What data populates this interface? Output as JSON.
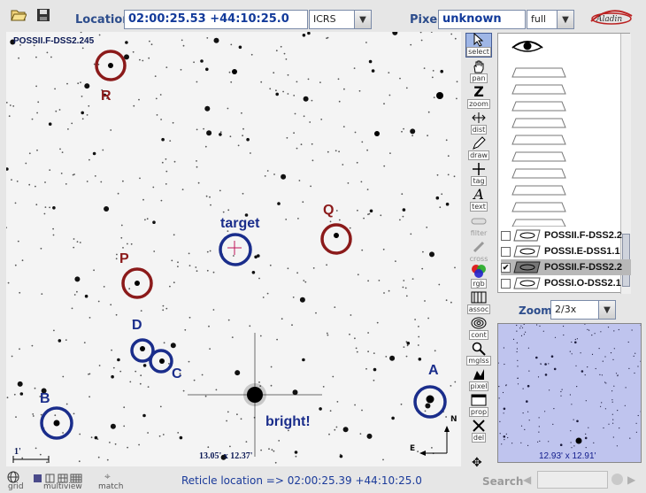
{
  "toolbar": {
    "location_label": "Location",
    "location_value": "02:00:25.53 +44:10:25.0",
    "frame_value": "ICRS",
    "pixel_label": "Pixel",
    "pixel_value": "unknown",
    "pixel_mode": "full",
    "logo_text": "Aladin"
  },
  "image": {
    "title": "POSSII.F-DSS2.245",
    "size_text": "13.05' x 12.37'",
    "scale_label": "1'",
    "compass_n": "N",
    "compass_e": "E",
    "annotations": [
      {
        "label": "R",
        "color": "#8b1a1a"
      },
      {
        "label": "Q",
        "color": "#8b1a1a"
      },
      {
        "label": "P",
        "color": "#8b1a1a"
      },
      {
        "label": "target",
        "color": "#1a2d8b"
      },
      {
        "label": "D",
        "color": "#1a2d8b"
      },
      {
        "label": "C",
        "color": "#1a2d8b"
      },
      {
        "label": "B",
        "color": "#1a2d8b"
      },
      {
        "label": "A",
        "color": "#1a2d8b"
      },
      {
        "label": "bright!",
        "color": "#1a2d8b"
      }
    ]
  },
  "tools": [
    {
      "name": "select",
      "icon": "arrow-icon",
      "selected": true
    },
    {
      "name": "pan",
      "icon": "hand-icon"
    },
    {
      "name": "zoom",
      "icon": "zoom-icon"
    },
    {
      "name": "dist",
      "icon": "distance-icon"
    },
    {
      "name": "draw",
      "icon": "pencil-icon"
    },
    {
      "name": "tag",
      "icon": "tag-icon"
    },
    {
      "name": "text",
      "icon": "text-icon"
    },
    {
      "name": "filter",
      "icon": "filter-icon",
      "disabled": true
    },
    {
      "name": "cross",
      "icon": "cross-icon",
      "disabled": true
    },
    {
      "name": "rgb",
      "icon": "rgb-icon"
    },
    {
      "name": "assoc",
      "icon": "assoc-icon"
    },
    {
      "name": "cont",
      "icon": "contour-icon"
    },
    {
      "name": "mglss",
      "icon": "magnifier-icon"
    },
    {
      "name": "pixel",
      "icon": "pixel-icon"
    },
    {
      "name": "prop",
      "icon": "properties-icon"
    },
    {
      "name": "del",
      "icon": "delete-icon"
    }
  ],
  "layers": [
    {
      "name": "POSSII.F-DSS2.2",
      "checked": false,
      "selected": false
    },
    {
      "name": "POSSI.E-DSS1.1",
      "checked": false,
      "selected": false
    },
    {
      "name": "POSSII.F-DSS2.2",
      "checked": true,
      "selected": true
    },
    {
      "name": "POSSI.O-DSS2.1",
      "checked": false,
      "selected": false
    }
  ],
  "zoom": {
    "label": "Zoom",
    "value": "2/3x"
  },
  "preview": {
    "size_text": "12.93' x 12.91'"
  },
  "bottom": {
    "grid_label": "grid",
    "multiview_label": "multiview",
    "match_label": "match",
    "status": "Reticle location => 02:00:25.39 +44:10:25.0",
    "search_label": "Search"
  }
}
